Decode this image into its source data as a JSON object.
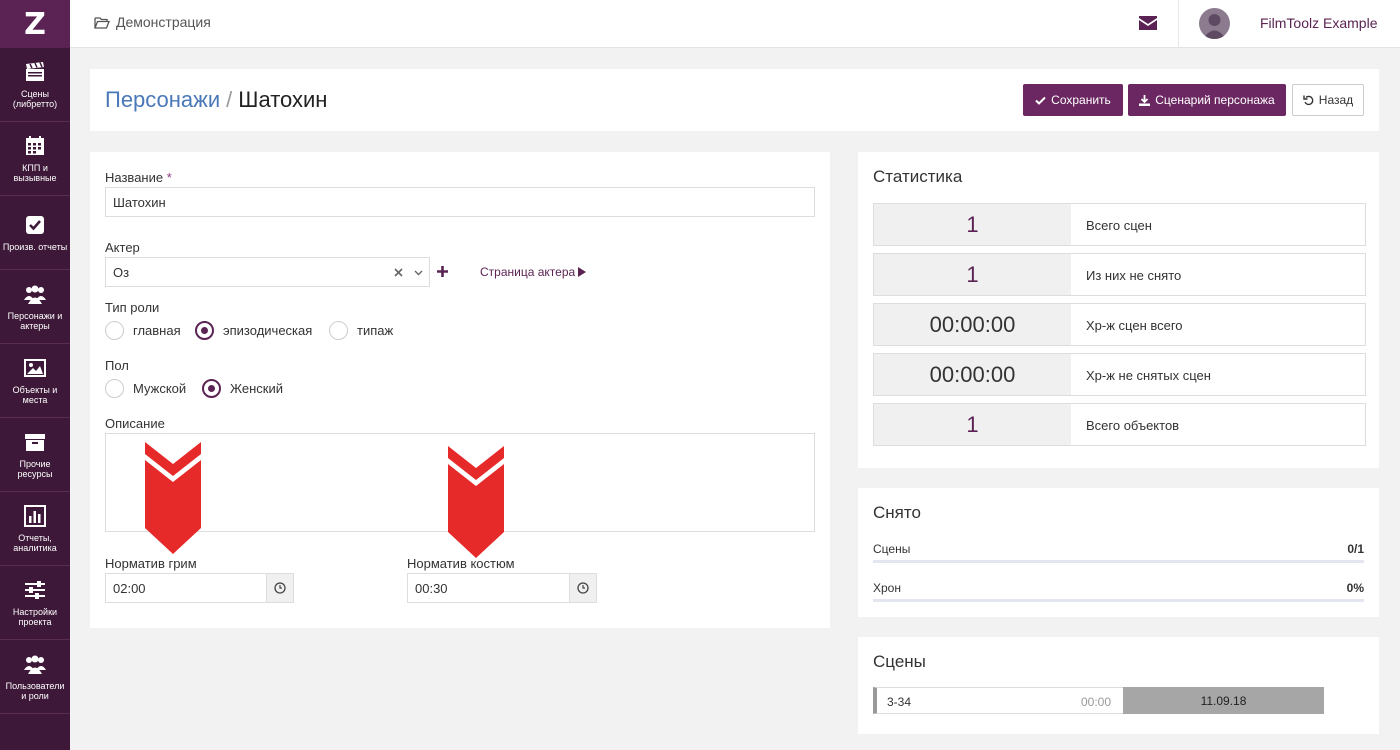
{
  "sidebar": {
    "logo": "Z",
    "items": [
      {
        "label": "Сцены (либретто)",
        "icon": "clapperboard-icon"
      },
      {
        "label": "КПП и вызывные",
        "icon": "calendar-icon"
      },
      {
        "label": "Произв. отчеты",
        "icon": "checkbox-icon"
      },
      {
        "label": "Персонажи и актеры",
        "icon": "users-icon"
      },
      {
        "label": "Объекты и места",
        "icon": "image-icon"
      },
      {
        "label": "Прочие ресурсы",
        "icon": "archive-icon"
      },
      {
        "label": "Отчеты, аналитика",
        "icon": "bar-chart-icon"
      },
      {
        "label": "Настройки проекта",
        "icon": "sliders-icon"
      },
      {
        "label": "Пользователи и роли",
        "icon": "users-icon"
      }
    ]
  },
  "topbar": {
    "project": "Демонстрация",
    "user_name": "FilmToolz Example"
  },
  "header": {
    "breadcrumb_link": "Персонажи",
    "separator": "/",
    "title": "Шатохин",
    "save_label": "Сохранить",
    "script_label": "Сценарий персонажа",
    "back_label": "Назад"
  },
  "form": {
    "name_label": "Название",
    "required_mark": "*",
    "name_value": "Шатохин",
    "actor_label": "Актер",
    "actor_value": "Оз",
    "actor_page_link": "Страница актера",
    "role_type_label": "Тип роли",
    "role_types": [
      {
        "label": "главная",
        "selected": false
      },
      {
        "label": "эпизодическая",
        "selected": true
      },
      {
        "label": "типаж",
        "selected": false
      }
    ],
    "gender_label": "Пол",
    "genders": [
      {
        "label": "Мужской",
        "selected": false
      },
      {
        "label": "Женский",
        "selected": true
      }
    ],
    "description_label": "Описание",
    "description_value": "",
    "makeup_label": "Норматив грим",
    "makeup_value": "02:00",
    "costume_label": "Норматив костюм",
    "costume_value": "00:30"
  },
  "stats": {
    "title": "Статистика",
    "rows": [
      {
        "value": "1",
        "label": "Всего сцен"
      },
      {
        "value": "1",
        "label": "Из них не снято"
      },
      {
        "value": "00:00:00",
        "label": "Хр-ж сцен всего"
      },
      {
        "value": "00:00:00",
        "label": "Хр-ж не снятых сцен"
      },
      {
        "value": "1",
        "label": "Всего объектов"
      }
    ]
  },
  "shot": {
    "title": "Снято",
    "scenes_label": "Сцены",
    "scenes_value": "0/1",
    "scenes_progress": 0,
    "chron_label": "Хрон",
    "chron_value": "0%",
    "chron_progress": 0
  },
  "scenes": {
    "title": "Сцены",
    "items": [
      {
        "number": "3-34",
        "duration": "00:00",
        "date": "11.09.18"
      }
    ]
  },
  "colors": {
    "sidebar": "#3d1838",
    "accent": "#6b2761",
    "link": "#4a78b8",
    "annotation_arrow": "#e62a2a"
  }
}
